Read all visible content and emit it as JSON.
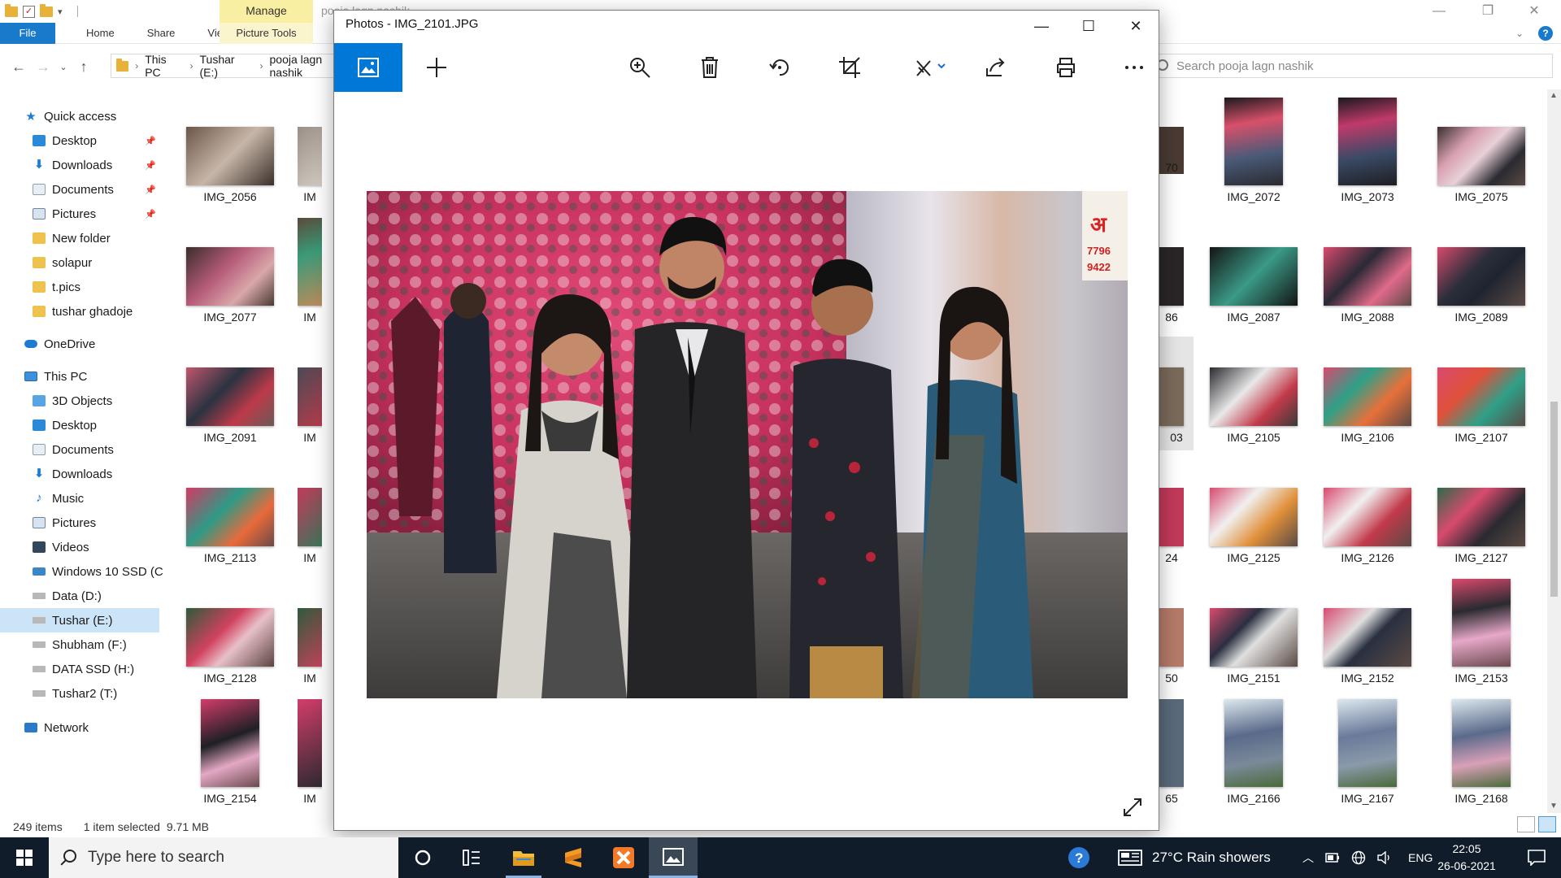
{
  "explorer": {
    "ribbon": {
      "manage_label": "Manage",
      "title_path": "pooja lagn nashik",
      "tabs": [
        "File",
        "Home",
        "Share",
        "View"
      ],
      "picture_tools_label": "Picture Tools"
    },
    "address": {
      "crumbs": [
        "This PC",
        "Tushar (E:)",
        "pooja lagn nashik"
      ]
    },
    "search": {
      "placeholder": "Search pooja lagn nashik"
    },
    "nav": {
      "quick_access": "Quick access",
      "quick_items": [
        "Desktop",
        "Downloads",
        "Documents",
        "Pictures",
        "New folder",
        "solapur",
        "t.pics",
        "tushar ghadoje"
      ],
      "onedrive": "OneDrive",
      "this_pc": "This PC",
      "pc_items": [
        "3D Objects",
        "Desktop",
        "Documents",
        "Downloads",
        "Music",
        "Pictures",
        "Videos",
        "Windows 10 SSD (C",
        "Data (D:)",
        "Tushar (E:)",
        "Shubham (F:)",
        "DATA SSD (H:)",
        "Tushar2 (T:)"
      ],
      "network": "Network"
    },
    "files_left": [
      "IMG_2056",
      "IMG_2077",
      "IMG_2091",
      "IMG_2113",
      "IMG_2128",
      "IMG_2154"
    ],
    "files_left_partial": [
      "IM",
      "IM",
      "IM",
      "IM",
      "IM",
      "IM"
    ],
    "files_partial_right": [
      "70",
      "86",
      "03",
      "24",
      "50",
      "65"
    ],
    "files_right": [
      [
        "IMG_2072",
        "IMG_2073",
        "IMG_2075"
      ],
      [
        "IMG_2087",
        "IMG_2088",
        "IMG_2089"
      ],
      [
        "IMG_2105",
        "IMG_2106",
        "IMG_2107"
      ],
      [
        "IMG_2125",
        "IMG_2126",
        "IMG_2127"
      ],
      [
        "IMG_2151",
        "IMG_2152",
        "IMG_2153"
      ],
      [
        "IMG_2166",
        "IMG_2167",
        "IMG_2168"
      ]
    ],
    "status": {
      "count": "249 items",
      "selection": "1 item selected",
      "size": "9.71 MB"
    }
  },
  "photos": {
    "title": "Photos - IMG_2101.JPG",
    "tools": [
      "view-photo",
      "add",
      "zoom",
      "delete",
      "rotate",
      "crop",
      "edit",
      "share",
      "print",
      "more"
    ]
  },
  "taskbar": {
    "search_placeholder": "Type here to search",
    "weather": "27°C  Rain showers",
    "lang": "ENG",
    "time": "22:05",
    "date": "26-06-2021"
  }
}
